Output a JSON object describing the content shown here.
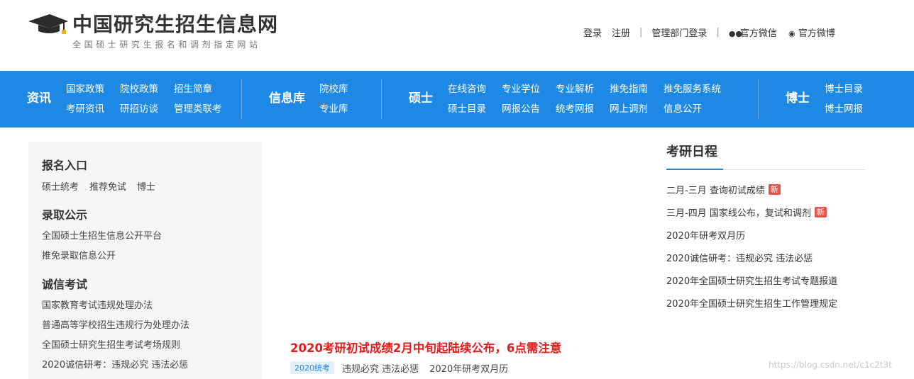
{
  "header": {
    "title": "中国研究生招生信息网",
    "subtitle": "全国硕士研究生报名和调剂指定网站",
    "links": {
      "login": "登录",
      "register": "注册",
      "sep": "|",
      "admin_login": "管理部门登录",
      "wechat": "官方微信",
      "weibo": "官方微博"
    },
    "icons": {
      "logo": "graduation-cap-icon",
      "wechat": "wechat-icon",
      "weibo": "weibo-icon"
    }
  },
  "nav": {
    "color": "#1e88e5",
    "groups": [
      {
        "title": "资讯",
        "links": [
          "国家政策",
          "院校政策",
          "招生简章",
          "考研资讯",
          "研招访谈",
          "管理类联考"
        ]
      },
      {
        "title": "信息库",
        "links": [
          "院校库",
          "专业库"
        ]
      },
      {
        "title": "硕士",
        "links": [
          "在线咨询",
          "专业学位",
          "专业解析",
          "推免指南",
          "推免服务系统",
          "硕士目录",
          "网报公告",
          "统考网报",
          "网上调剂",
          "信息公开"
        ]
      },
      {
        "title": "博士",
        "links": [
          "博士目录",
          "博士网报"
        ]
      }
    ]
  },
  "left": {
    "sections": [
      {
        "title": "报名入口",
        "links": [
          "硕士统考",
          "推荐免试",
          "博士"
        ]
      },
      {
        "title": "录取公示",
        "links": [
          "全国硕士生招生信息公开平台",
          "推免录取信息公开"
        ]
      },
      {
        "title": "诚信考试",
        "links": [
          "国家教育考试违规处理办法",
          "普通高等学校招生违规行为处理办法",
          "全国硕士研究生招生考试考场规则",
          "2020诚信研考：违规必究 违法必惩"
        ]
      }
    ]
  },
  "main": {
    "headline": "2020考研初试成绩2月中旬起陆续公布，6点需注意",
    "tag": "2020统考",
    "sublinks": [
      "违规必究 违法必惩",
      "2020年研考双月历"
    ]
  },
  "schedule": {
    "title": "考研日程",
    "badge": "新",
    "items": [
      "二月-三月 查询初试成绩",
      "三月-四月 国家线公布，复试和调剂",
      "2020年研考双月历",
      "2020诚信研考：违规必究 违法必惩",
      "2020年全国硕士研究生招生考试专题报道",
      "2020年全国硕士研究生招生工作管理规定"
    ]
  },
  "watermark": "https://blog.csdn.net/c1c2t3t"
}
